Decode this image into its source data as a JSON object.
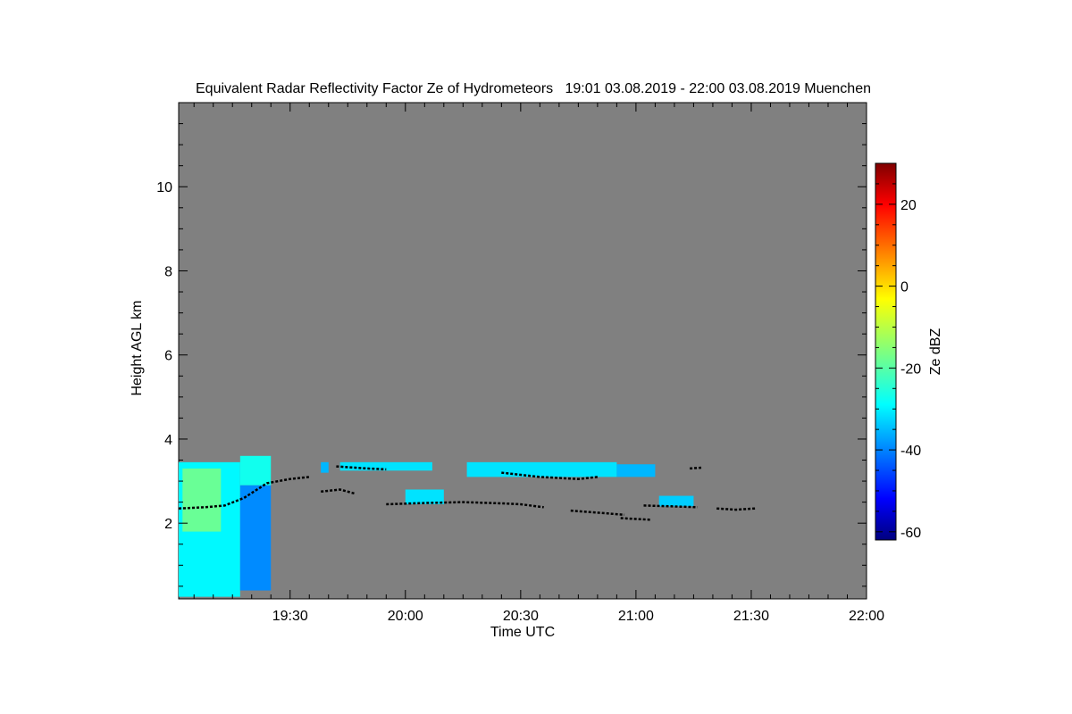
{
  "chart_data": {
    "type": "heatmap",
    "title": "Equivalent Radar Reflectivity Factor Ze of Hydrometeors   19:01 03.08.2019 - 22:00 03.08.2019 Muenchen",
    "xlabel": "Time UTC",
    "ylabel": "Height AGL km",
    "x_unit": "UTC time",
    "y_unit": "km",
    "xlim": [
      "19:01",
      "22:00"
    ],
    "ylim": [
      0.2,
      12.0
    ],
    "xticks": [
      "19:30",
      "20:00",
      "20:30",
      "21:00",
      "21:30",
      "22:00"
    ],
    "yticks": [
      2,
      4,
      6,
      8,
      10
    ],
    "background_color": "#808080",
    "grid": false,
    "colorbar": {
      "label": "Ze dBZ",
      "range": [
        -62,
        30
      ],
      "ticks": [
        -60,
        -40,
        -20,
        0,
        20
      ],
      "colormap": "jet",
      "position": "right"
    },
    "echo_regions": [
      {
        "t0": "19:01",
        "t1": "19:17",
        "h0": 0.25,
        "h1": 3.45,
        "dbz": -28
      },
      {
        "t0": "19:17",
        "t1": "19:25",
        "h0": 2.9,
        "h1": 3.6,
        "dbz": -26
      },
      {
        "t0": "19:02",
        "t1": "19:12",
        "h0": 1.8,
        "h1": 3.3,
        "dbz": -18
      },
      {
        "t0": "19:17",
        "t1": "19:25",
        "h0": 0.4,
        "h1": 2.9,
        "dbz": -38
      },
      {
        "t0": "19:38",
        "t1": "19:40",
        "h0": 3.2,
        "h1": 3.45,
        "dbz": -34
      },
      {
        "t0": "19:43",
        "t1": "20:07",
        "h0": 3.25,
        "h1": 3.45,
        "dbz": -30
      },
      {
        "t0": "20:00",
        "t1": "20:10",
        "h0": 2.45,
        "h1": 2.8,
        "dbz": -30
      },
      {
        "t0": "20:16",
        "t1": "20:55",
        "h0": 3.1,
        "h1": 3.45,
        "dbz": -30
      },
      {
        "t0": "20:55",
        "t1": "21:05",
        "h0": 3.1,
        "h1": 3.4,
        "dbz": -34
      },
      {
        "t0": "21:06",
        "t1": "21:15",
        "h0": 2.4,
        "h1": 2.65,
        "dbz": -32
      }
    ],
    "cloud_base_series": [
      {
        "x": [
          "19:01",
          "19:08",
          "19:13",
          "19:18",
          "19:24",
          "19:30",
          "19:35"
        ],
        "y": [
          2.35,
          2.38,
          2.42,
          2.6,
          2.95,
          3.05,
          3.1
        ]
      },
      {
        "x": [
          "19:42",
          "19:50",
          "19:55"
        ],
        "y": [
          3.35,
          3.3,
          3.28
        ]
      },
      {
        "x": [
          "19:38",
          "19:43",
          "19:47"
        ],
        "y": [
          2.75,
          2.8,
          2.7
        ]
      },
      {
        "x": [
          "19:55",
          "20:05",
          "20:15",
          "20:25",
          "20:30",
          "20:36"
        ],
        "y": [
          2.45,
          2.48,
          2.5,
          2.47,
          2.45,
          2.38
        ]
      },
      {
        "x": [
          "20:25",
          "20:35",
          "20:45",
          "20:50"
        ],
        "y": [
          3.2,
          3.1,
          3.05,
          3.1
        ]
      },
      {
        "x": [
          "20:43",
          "20:50",
          "20:57"
        ],
        "y": [
          2.3,
          2.25,
          2.2
        ]
      },
      {
        "x": [
          "20:56",
          "21:00",
          "21:04"
        ],
        "y": [
          2.12,
          2.1,
          2.08
        ]
      },
      {
        "x": [
          "21:02",
          "21:09",
          "21:16"
        ],
        "y": [
          2.42,
          2.4,
          2.38
        ]
      },
      {
        "x": [
          "21:21",
          "21:26",
          "21:31"
        ],
        "y": [
          2.35,
          2.32,
          2.35
        ]
      },
      {
        "x": [
          "21:14",
          "21:17"
        ],
        "y": [
          3.3,
          3.32
        ]
      }
    ]
  }
}
